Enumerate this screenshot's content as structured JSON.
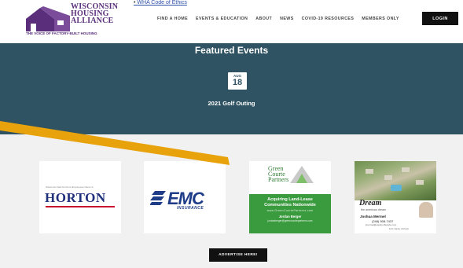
{
  "header": {
    "ethics_link": "WHA Code of Ethics",
    "logo": {
      "line1": "WISCONSIN",
      "line2": "HOUSING",
      "line3": "ALLIANCE",
      "tagline": "THE VOICE OF FACTORY-BUILT HOUSING"
    },
    "nav": [
      "FIND A HOME",
      "EVENTS & EDUCATION",
      "ABOUT",
      "NEWS",
      "COVID-19 RESOURCES",
      "MEMBERS ONLY"
    ],
    "login_label": "LOGIN"
  },
  "featured": {
    "title": "Featured Events",
    "event": {
      "month": "AUG",
      "day": "18",
      "title": "2021 Golf Outing"
    }
  },
  "sponsors": {
    "horton": {
      "small": "Wisconsin Well Horizons Employees Name is",
      "name": "HORTON"
    },
    "emc": {
      "name": "EMC",
      "sub": "INSURANCE"
    },
    "green_courte": {
      "logo_line1": "Green",
      "logo_line2": "Courte",
      "logo_line3": "Partners",
      "headline_line1": "Acquiring Land-Lease",
      "headline_line2": "Communities Nationwide",
      "url": "www.GreenCourtePartners.com",
      "contact_name": "Jordan Berger",
      "contact_email": "jordanberger@greencourtepartners.com"
    },
    "dream": {
      "title": "Dream",
      "subtitle": "the american dream",
      "name": "Joshua Mermel",
      "phone": "(248) 508-7437",
      "email": "jmermel@equity-lifestyle.com",
      "footer": "ELS | Equity LifeStyle"
    },
    "advertise_label": "ADVERTISE HERE!"
  },
  "colors": {
    "featured_bg": "#2f5362",
    "sponsors_bg": "#f1f1f1",
    "arrow": "#e8a20c",
    "logo_purple": "#5a2e7a",
    "button_black": "#111111"
  }
}
